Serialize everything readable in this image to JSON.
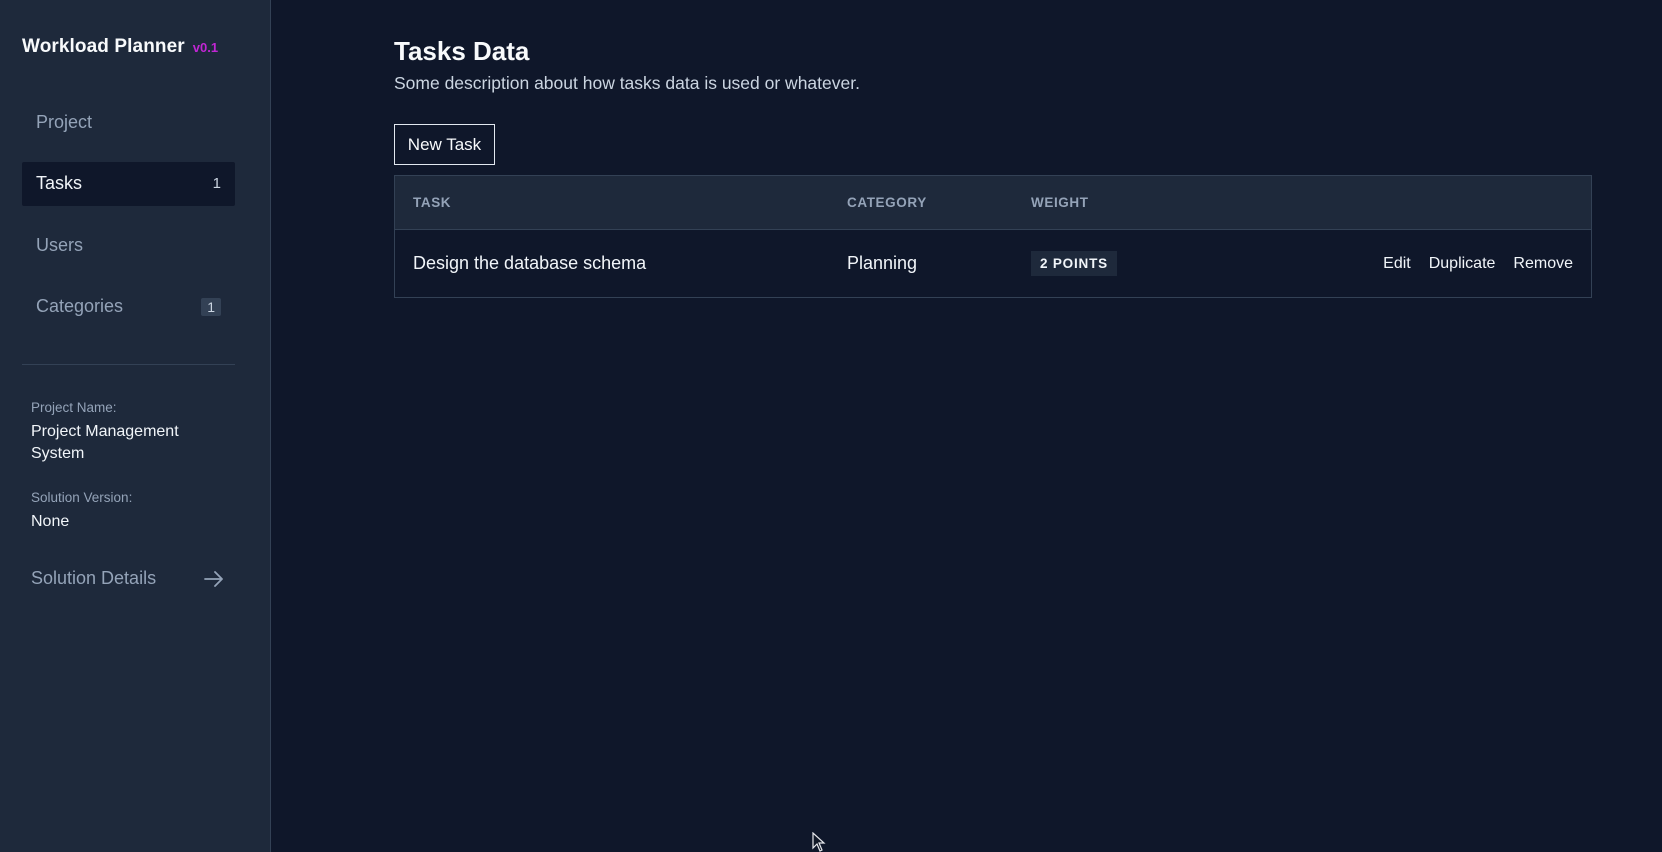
{
  "app": {
    "name": "Workload Planner",
    "version": "v0.1"
  },
  "sidebar": {
    "items": [
      {
        "label": "Project",
        "count": ""
      },
      {
        "label": "Tasks",
        "count": "1"
      },
      {
        "label": "Users",
        "count": ""
      },
      {
        "label": "Categories",
        "count": "1"
      }
    ],
    "project_name_label": "Project Name:",
    "project_name_value": "Project Management System",
    "solution_version_label": "Solution Version:",
    "solution_version_value": "None",
    "solution_details_label": "Solution Details",
    "solution_details_icon": "arrow-right-icon"
  },
  "main": {
    "title": "Tasks Data",
    "description": "Some description about how tasks data is used or whatever.",
    "new_task_label": "New Task",
    "table": {
      "headers": [
        "TASK",
        "CATEGORY",
        "WEIGHT"
      ],
      "rows": [
        {
          "task": "Design the database schema",
          "category": "Planning",
          "weight": "2 POINTS",
          "actions": [
            "Edit",
            "Duplicate",
            "Remove"
          ]
        }
      ]
    }
  },
  "colors": {
    "background": "#0f172a",
    "sidebar": "#1e293b",
    "accent_version": "#c026d3"
  }
}
